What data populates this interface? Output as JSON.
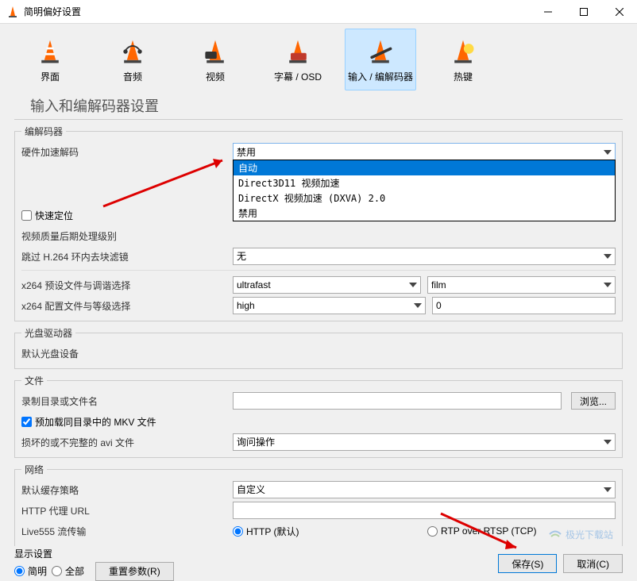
{
  "window": {
    "title": "简明偏好设置"
  },
  "tabs": {
    "items": [
      {
        "label": "界面",
        "icon": "cone"
      },
      {
        "label": "音频",
        "icon": "headphones"
      },
      {
        "label": "视频",
        "icon": "video"
      },
      {
        "label": "字幕 / OSD",
        "icon": "subtitle"
      },
      {
        "label": "输入 / 编解码器",
        "icon": "codec"
      },
      {
        "label": "热键",
        "icon": "hotkey"
      }
    ],
    "active_index": 4
  },
  "section_title": "输入和编解码器设置",
  "groups": {
    "codec": {
      "legend": "编解码器",
      "hw_decode_label": "硬件加速解码",
      "hw_decode_value": "禁用",
      "hw_decode_options": [
        "自动",
        "Direct3D11 视频加速",
        "DirectX 视频加速 (DXVA) 2.0",
        "禁用"
      ],
      "fast_seek_label": "快速定位",
      "post_process_label": "视频质量后期处理级别",
      "skip_loop_label": "跳过 H.264 环内去块滤镜",
      "skip_loop_value": "无",
      "x264_preset_label": "x264 预设文件与调谐选择",
      "x264_preset_value": "ultrafast",
      "x264_tune_value": "film",
      "x264_profile_label": "x264 配置文件与等级选择",
      "x264_profile_value": "high",
      "x264_level_value": "0"
    },
    "disc": {
      "legend": "光盘驱动器",
      "default_disc_label": "默认光盘设备"
    },
    "file": {
      "legend": "文件",
      "record_dir_label": "录制目录或文件名",
      "browse_label": "浏览...",
      "preload_mkv_label": "预加载同目录中的 MKV 文件",
      "broken_avi_label": "损坏的或不完整的 avi 文件",
      "broken_avi_value": "询问操作"
    },
    "network": {
      "legend": "网络",
      "cache_policy_label": "默认缓存策略",
      "cache_policy_value": "自定义",
      "http_proxy_label": "HTTP 代理 URL",
      "live555_label": "Live555 流传输",
      "http_radio": "HTTP (默认)",
      "rtp_radio": "RTP over RTSP (TCP)"
    }
  },
  "bottom": {
    "show_settings_label": "显示设置",
    "simple_label": "简明",
    "all_label": "全部",
    "reset_label": "重置参数(R)",
    "save_label": "保存(S)",
    "cancel_label": "取消(C)"
  },
  "watermark": "极光下载站"
}
